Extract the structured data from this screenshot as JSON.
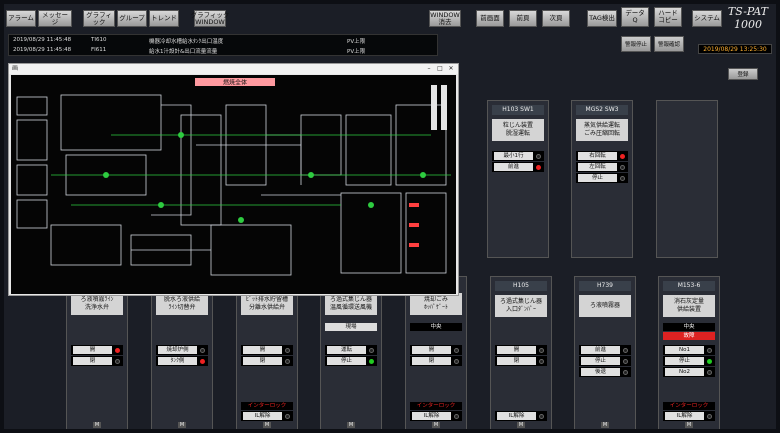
{
  "toolbar": {
    "alarm": "アラーム",
    "message": "メッセージ",
    "graphic": "グラフィック",
    "group": "グループ",
    "trend": "トレンド",
    "graphic_window": "グラフィック\nWINDOW",
    "window_close": "WINDOW\n消去",
    "prev_page": "前画面",
    "next_page": "前頁",
    "next": "次頁",
    "tag_search": "TAG検出",
    "dq": "データ\nQ",
    "hard": "ハード\nコピー",
    "system": "システム"
  },
  "brand": {
    "line1": "TS-PAT",
    "line2": "1000"
  },
  "alarm_buttons": {
    "stop": "警報停止",
    "confirm": "警報確認"
  },
  "clock": "2019/08/29 13:25:30",
  "alarms": [
    {
      "time": "2019/08/29 11:45:48",
      "tag": "TI610",
      "desc": "機器冷却水槽給水ﾀﾝｸ出口温度",
      "state": "PV上限"
    },
    {
      "time": "2019/08/29 11:45:48",
      "tag": "FI611",
      "desc": "給水1汁設計&出口流量流量",
      "state": "PV上限"
    }
  ],
  "release_button": "登録",
  "popup": {
    "title": "画",
    "schematic_title": "燃焼全体"
  },
  "cards_top": [
    {
      "head": "H103 SW1",
      "body": "粒じん装置\n脱湿運転",
      "rows": [
        {
          "label": "最小1行",
          "lamp": "#222"
        },
        {
          "label": "前進",
          "lamp": "#e22"
        }
      ]
    },
    {
      "head": "MGS2 SW3",
      "body": "蒸気供給運転\nごみ圧縮回転",
      "rows": [
        {
          "label": "右回転",
          "lamp": "#e22"
        },
        {
          "label": "左回転",
          "lamp": "#222"
        },
        {
          "label": "停止",
          "lamp": "#222"
        }
      ]
    }
  ],
  "cards_bottom": [
    {
      "head": "",
      "body": "ろ液噴霧ﾗｲﾝ\n洗浄水弁",
      "rows": [
        {
          "label": "開",
          "lamp": "#e22"
        },
        {
          "label": "閉",
          "lamp": "#222"
        }
      ],
      "tag": "",
      "tagc": "#000",
      "foot": "M"
    },
    {
      "head": "",
      "body": "脱水ろ液供給\nﾗｲﾝ切替弁",
      "rows": [
        {
          "label": "焼却炉側",
          "lamp": "#222"
        },
        {
          "label": "ﾀﾝｸ側",
          "lamp": "#e22"
        }
      ],
      "tag": "",
      "tagc": "#000",
      "foot": "M"
    },
    {
      "head": "",
      "body": "ﾋﾟｯﾄ排水貯留槽\n分離水供給弁",
      "rows": [
        {
          "label": "開",
          "lamp": "#222"
        },
        {
          "label": "閉",
          "lamp": "#222"
        }
      ],
      "tag": "インターロック",
      "tagc": "#e22",
      "foot": "M",
      "tag2": "IL解除"
    },
    {
      "head": "",
      "body": "ろ過式集じん器\n温風循環送風機",
      "rows": [
        {
          "label": "運転",
          "lamp": "#222"
        },
        {
          "label": "停止",
          "lamp": "#2c2"
        }
      ],
      "tag": "現場",
      "tagc": "#ffffff",
      "foot": "M"
    },
    {
      "head": "",
      "body": "焼却ごみ\nﾎｯﾊﾟｹﾞｰﾄ",
      "rows": [
        {
          "label": "開",
          "lamp": "#222"
        },
        {
          "label": "閉",
          "lamp": "#222"
        }
      ],
      "tag": "インターロック",
      "tagc": "#e22",
      "foot": "M",
      "tag2": "IL解除",
      "mode": "中央"
    },
    {
      "head": "H105",
      "body": "ろ過式集じん器\n入口ﾀﾞﾝﾊﾟｰ",
      "rows": [
        {
          "label": "開",
          "lamp": "#222"
        },
        {
          "label": "閉",
          "lamp": "#222"
        }
      ],
      "tag": "",
      "tagc": "#000",
      "foot": "M",
      "tag2": "IL解除"
    },
    {
      "head": "H739",
      "body": "ろ液噴霧器",
      "rows": [
        {
          "label": "前進",
          "lamp": "#222"
        },
        {
          "label": "停止",
          "lamp": "#222"
        },
        {
          "label": "後退",
          "lamp": "#222"
        }
      ],
      "tag": "",
      "tagc": "#000",
      "foot": "M"
    },
    {
      "head": "M153-6",
      "body": "消石灰定量\n供給装置",
      "rows": [
        {
          "label": "No1",
          "lamp": "#222"
        },
        {
          "label": "停止",
          "lamp": "#2c2"
        },
        {
          "label": "No2",
          "lamp": "#222"
        }
      ],
      "tag": "インターロック",
      "tagc": "#e22",
      "foot": "M",
      "tag2": "IL解除",
      "mode": "中央",
      "fault": "故障"
    }
  ]
}
